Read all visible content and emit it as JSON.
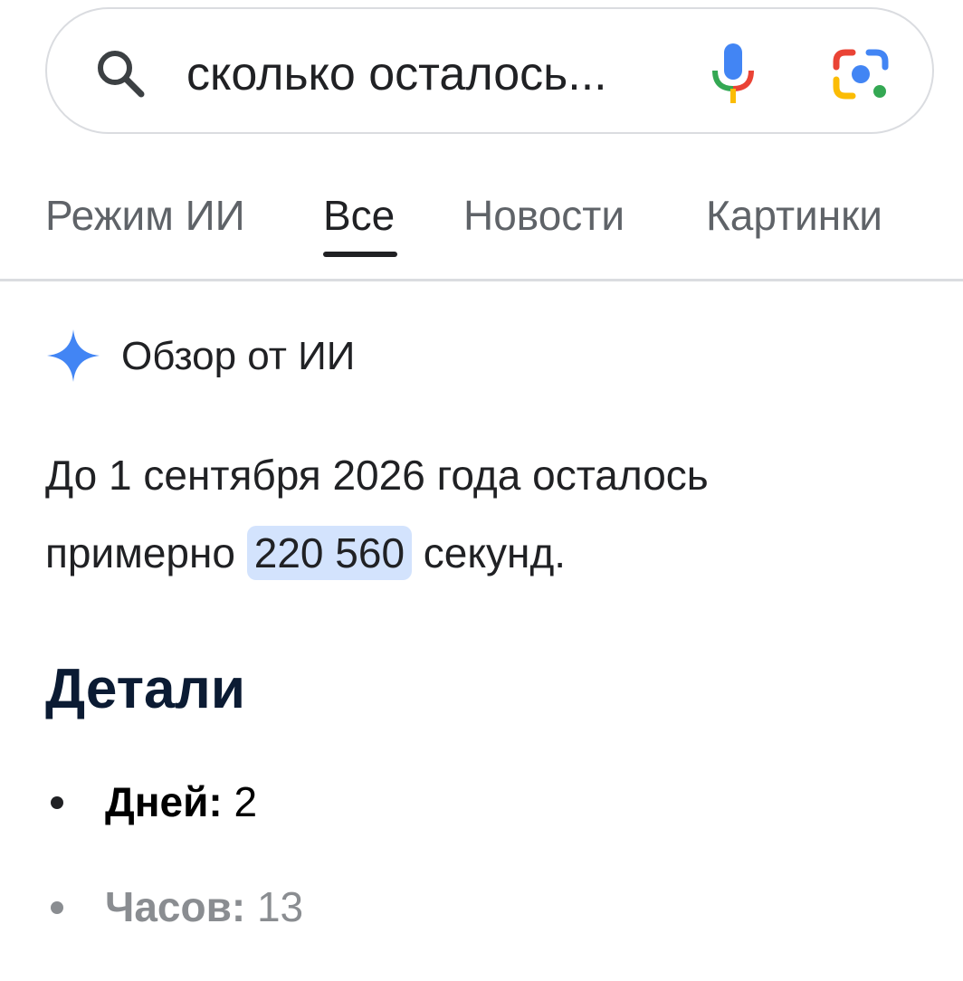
{
  "search": {
    "query": "сколько осталось...",
    "icons": {
      "search": "search-icon",
      "voice": "microphone-icon",
      "lens": "google-lens-icon"
    }
  },
  "tabs": [
    {
      "label": "Режим ИИ",
      "active": false
    },
    {
      "label": "Все",
      "active": true
    },
    {
      "label": "Новости",
      "active": false
    },
    {
      "label": "Картинки",
      "active": false
    }
  ],
  "ai_overview": {
    "title": "Обзор от ИИ",
    "icon": "sparkle-icon",
    "answer_line1": "До 1 сентября 2026 года осталось",
    "answer_prefix": "примерно ",
    "answer_highlight": "220 560",
    "answer_suffix": " секунд."
  },
  "details": {
    "title": "Детали",
    "items": [
      {
        "label": "Дней:",
        "value": "2"
      },
      {
        "label": "Часов:",
        "value": "13"
      }
    ]
  },
  "colors": {
    "highlight": "#d3e3fd",
    "sparkle": "#4285f4",
    "google_blue": "#4285f4",
    "google_red": "#ea4335",
    "google_yellow": "#fbbc04",
    "google_green": "#34a853"
  }
}
